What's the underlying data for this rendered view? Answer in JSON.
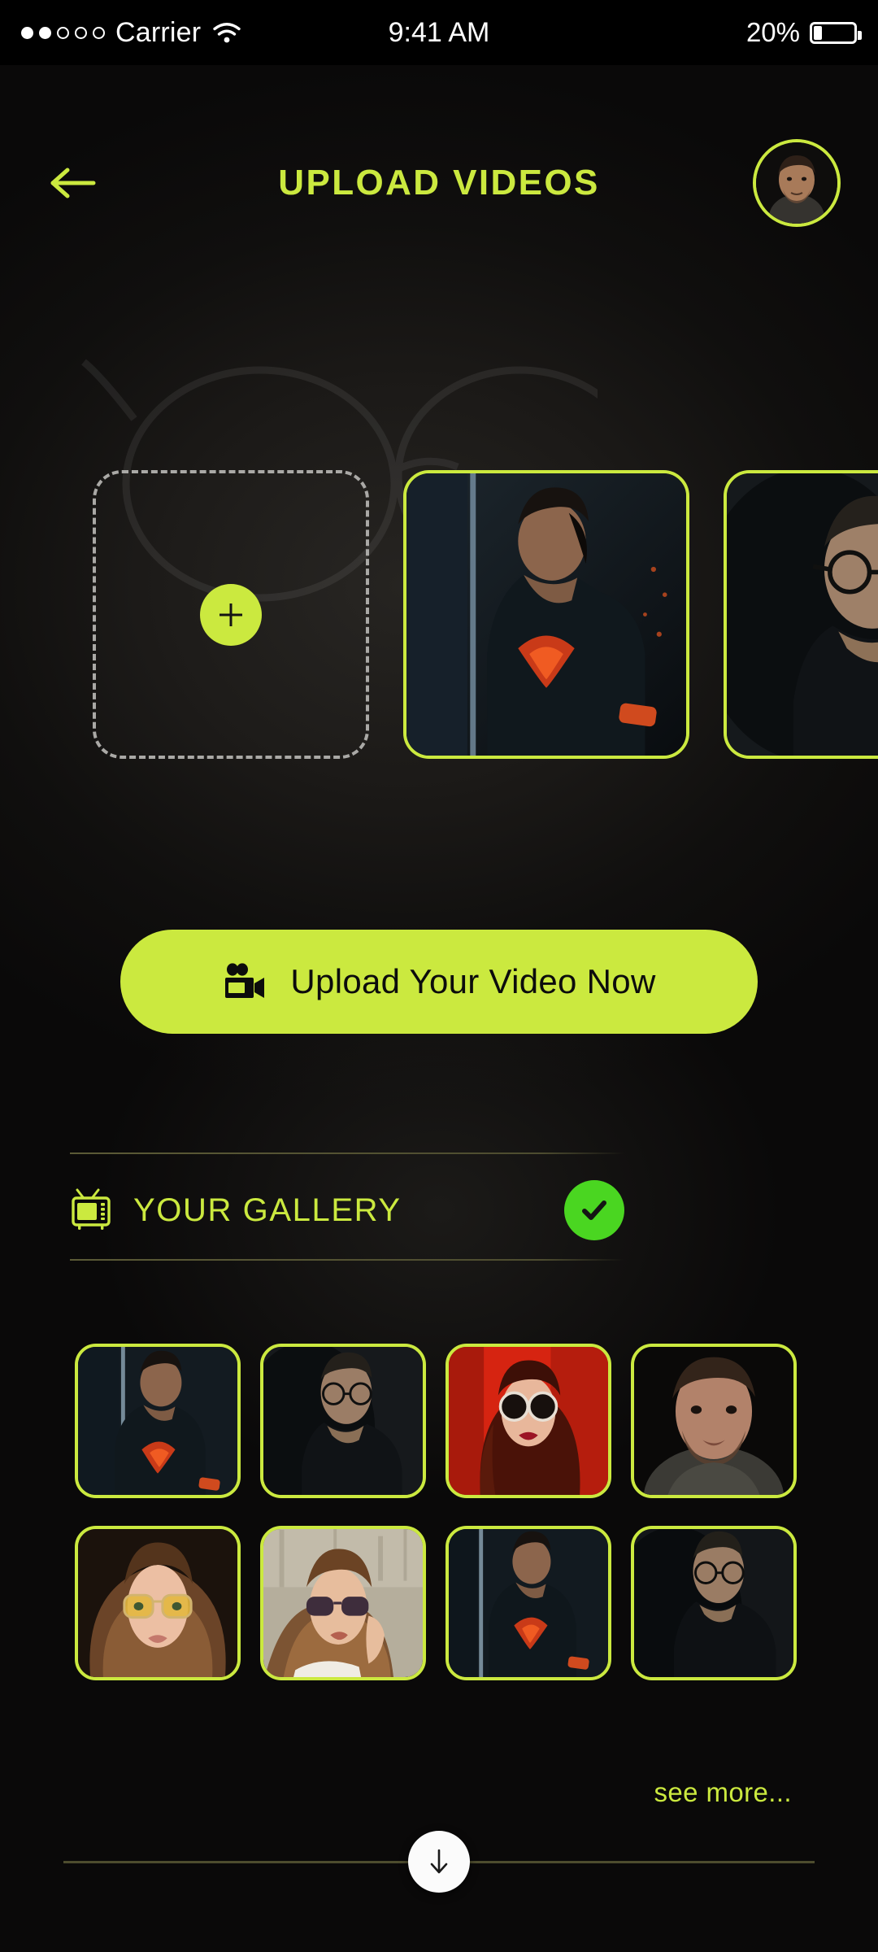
{
  "status_bar": {
    "carrier": "Carrier",
    "signal_dots_filled": 2,
    "signal_dots_total": 5,
    "wifi_icon": "wifi-icon",
    "time": "9:41 AM",
    "battery_percent_label": "20%",
    "battery_percent": 20
  },
  "header": {
    "back_icon": "arrow-left-icon",
    "title": "UPLOAD VIDEOS",
    "avatar_icon": "avatar"
  },
  "colors": {
    "accent_lime": "#cbe93f",
    "check_green": "#4ad621",
    "background": "#0c0b0a",
    "divider_olive": "#4d4c2e",
    "dashed_border": "#aaa9a6"
  },
  "upload_strip": {
    "add_card": {
      "name": "add-video-card",
      "icon": "plus-icon"
    },
    "thumbnails": [
      {
        "name": "video-thumb-superman",
        "alt": "Man in superman t-shirt"
      },
      {
        "name": "video-thumb-glasses-jacket",
        "alt": "Man with glasses in black jacket"
      }
    ]
  },
  "upload_cta": {
    "icon": "video-camera-icon",
    "label": "Upload Your Video Now"
  },
  "gallery": {
    "icon": "television-icon",
    "title": "YOUR GALLERY",
    "check_icon": "check-icon",
    "see_more_label": "see more...",
    "rows": [
      [
        {
          "name": "gallery-thumb-superman",
          "alt": "Man in superman t-shirt"
        },
        {
          "name": "gallery-thumb-glasses-jacket",
          "alt": "Man with glasses in black jacket"
        },
        {
          "name": "gallery-thumb-red-sunglasses",
          "alt": "Woman with sunglasses on red background"
        },
        {
          "name": "gallery-thumb-bearded-man",
          "alt": "Bearded man portrait"
        }
      ],
      [
        {
          "name": "gallery-thumb-yellow-glasses",
          "alt": "Woman with yellow tinted glasses"
        },
        {
          "name": "gallery-thumb-wall-sunglasses",
          "alt": "Woman with sunglasses against wall"
        },
        {
          "name": "gallery-thumb-superman-2",
          "alt": "Man in superman t-shirt"
        },
        {
          "name": "gallery-thumb-glasses-jacket-2",
          "alt": "Man with glasses in black jacket"
        }
      ]
    ]
  },
  "scroll": {
    "down_icon": "arrow-down-icon"
  }
}
